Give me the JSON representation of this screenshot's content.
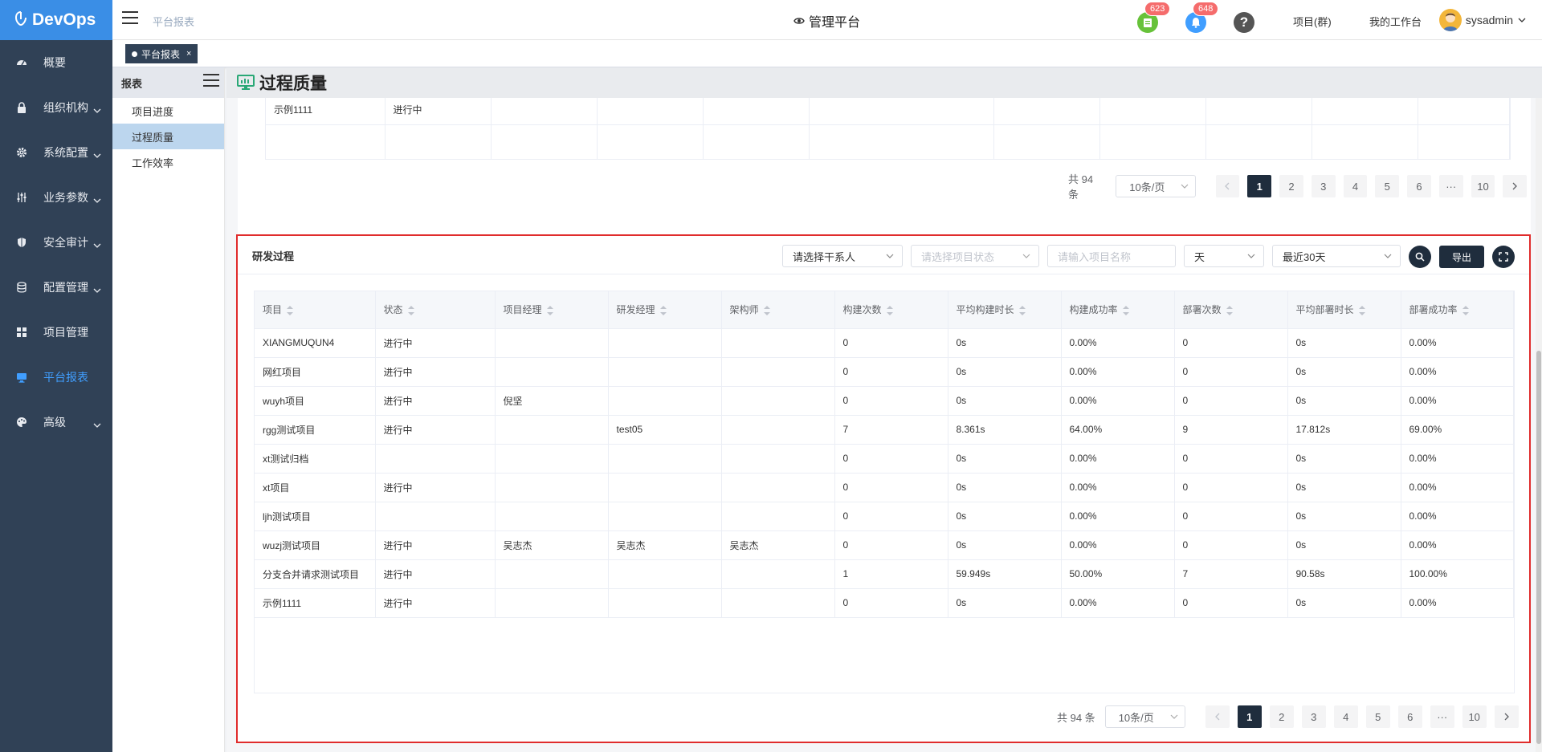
{
  "app": {
    "logo_text": "DevOps"
  },
  "sidebar": {
    "items": [
      {
        "label": "概要",
        "icon": "dashboard-icon",
        "has_arrow": false
      },
      {
        "label": "组织机构",
        "icon": "lock-icon",
        "has_arrow": true
      },
      {
        "label": "系统配置",
        "icon": "gear-icon",
        "has_arrow": true
      },
      {
        "label": "业务参数",
        "icon": "sliders-icon",
        "has_arrow": true
      },
      {
        "label": "安全审计",
        "icon": "shield-icon",
        "has_arrow": true
      },
      {
        "label": "配置管理",
        "icon": "database-icon",
        "has_arrow": true
      },
      {
        "label": "项目管理",
        "icon": "grid-icon",
        "has_arrow": false
      },
      {
        "label": "平台报表",
        "icon": "monitor-icon",
        "has_arrow": false,
        "active": true
      },
      {
        "label": "高级",
        "icon": "palette-icon",
        "has_arrow": true
      }
    ]
  },
  "header": {
    "breadcrumb": "平台报表",
    "center_title": "管理平台",
    "badge_todo": "623",
    "badge_notice": "648",
    "link_projects": "项目(群)",
    "link_workbench": "我的工作台",
    "username": "sysadmin",
    "colors": {
      "todo": "#67c23a",
      "notice": "#409eff",
      "help": "#555555",
      "badge": "#f56c6c"
    }
  },
  "tags": {
    "active_tag": "平台报表"
  },
  "subnav": {
    "title": "报表",
    "items": [
      "项目进度",
      "过程质量",
      "工作效率"
    ],
    "active_index": 1
  },
  "page": {
    "title": "过程质量"
  },
  "top_card": {
    "partial_row": [
      "示例1111",
      "进行中",
      "",
      "",
      "",
      "",
      "",
      "",
      "",
      "",
      ""
    ],
    "pager": {
      "total": "共 94 条",
      "page_size": "10条/页",
      "pages": [
        "1",
        "2",
        "3",
        "4",
        "5",
        "6",
        "···",
        "10"
      ],
      "current": "1"
    }
  },
  "dev_card": {
    "title": "研发过程",
    "filters": {
      "stakeholder": "请选择干系人",
      "status_placeholder": "请选择项目状态",
      "name_placeholder": "请输入项目名称",
      "unit": "天",
      "range": "最近30天"
    },
    "export_label": "导出",
    "columns": [
      "项目",
      "状态",
      "项目经理",
      "研发经理",
      "架构师",
      "构建次数",
      "平均构建时长",
      "构建成功率",
      "部署次数",
      "平均部署时长",
      "部署成功率"
    ],
    "rows": [
      [
        "XIANGMUQUN4",
        "进行中",
        "",
        "",
        "",
        "0",
        "0s",
        "0.00%",
        "0",
        "0s",
        "0.00%"
      ],
      [
        "网红项目",
        "进行中",
        "",
        "",
        "",
        "0",
        "0s",
        "0.00%",
        "0",
        "0s",
        "0.00%"
      ],
      [
        "wuyh项目",
        "进行中",
        "倪坚",
        "",
        "",
        "0",
        "0s",
        "0.00%",
        "0",
        "0s",
        "0.00%"
      ],
      [
        "rgg测试项目",
        "进行中",
        "",
        "test05",
        "",
        "7",
        "8.361s",
        "64.00%",
        "9",
        "17.812s",
        "69.00%"
      ],
      [
        "xt测试归档",
        "",
        "",
        "",
        "",
        "0",
        "0s",
        "0.00%",
        "0",
        "0s",
        "0.00%"
      ],
      [
        "xt项目",
        "进行中",
        "",
        "",
        "",
        "0",
        "0s",
        "0.00%",
        "0",
        "0s",
        "0.00%"
      ],
      [
        "ljh测试项目",
        "",
        "",
        "",
        "",
        "0",
        "0s",
        "0.00%",
        "0",
        "0s",
        "0.00%"
      ],
      [
        "wuzj测试项目",
        "进行中",
        "吴志杰",
        "吴志杰",
        "吴志杰",
        "0",
        "0s",
        "0.00%",
        "0",
        "0s",
        "0.00%"
      ],
      [
        "分支合并请求测试项目",
        "进行中",
        "",
        "",
        "",
        "1",
        "59.949s",
        "50.00%",
        "7",
        "90.58s",
        "100.00%"
      ],
      [
        "示例1111",
        "进行中",
        "",
        "",
        "",
        "0",
        "0s",
        "0.00%",
        "0",
        "0s",
        "0.00%"
      ]
    ],
    "pager": {
      "total": "共 94 条",
      "page_size": "10条/页",
      "pages": [
        "1",
        "2",
        "3",
        "4",
        "5",
        "6",
        "···",
        "10"
      ],
      "current": "1"
    }
  }
}
